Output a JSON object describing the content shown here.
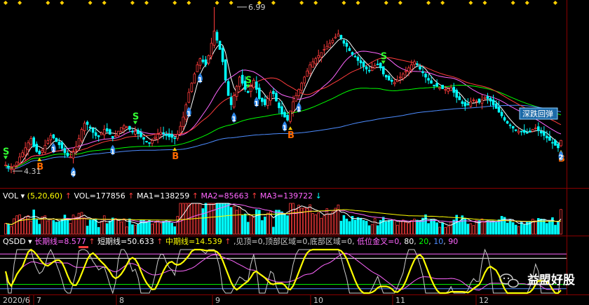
{
  "price_panel": {
    "high_label": "6.99",
    "low_label": "4.31",
    "deep_dip_label": "深跌回弹",
    "signals": [
      {
        "type": "S",
        "label": "S",
        "index": 0
      },
      {
        "type": "B",
        "label": "B",
        "index": 12
      },
      {
        "type": "n",
        "label": "1",
        "index": 17
      },
      {
        "type": "n",
        "label": "4",
        "index": 24
      },
      {
        "type": "n",
        "label": "1",
        "index": 38
      },
      {
        "type": "S",
        "label": "S",
        "index": 46
      },
      {
        "type": "B",
        "label": "B",
        "index": 60
      },
      {
        "type": "n",
        "label": "1",
        "index": 65
      },
      {
        "type": "n",
        "label": "1",
        "index": 69
      },
      {
        "type": "n",
        "label": "1",
        "index": 81
      },
      {
        "type": "S",
        "label": "S",
        "index": 86
      },
      {
        "type": "n",
        "label": "1",
        "index": 89
      },
      {
        "type": "B",
        "label": "B",
        "index": 101
      },
      {
        "type": "n",
        "label": "1",
        "index": 99
      },
      {
        "type": "n",
        "label": "1",
        "index": 104
      },
      {
        "type": "S",
        "label": "S",
        "index": 134
      },
      {
        "type": "B",
        "label": "B",
        "index": 197
      },
      {
        "type": "n",
        "label": "2",
        "index": 197
      }
    ]
  },
  "vol_panel": {
    "name": "VOL",
    "params": "(5,20,60)",
    "vol": "VOL=177856",
    "ma1": "MA1=138259",
    "ma2": "MA2=85663",
    "ma3": "MA3=139722"
  },
  "qsdd_panel": {
    "name": "QSDD",
    "long": "长期线=8.577",
    "short": "短期线=50.633",
    "mid": "中期线=14.539",
    "rest_a": ",见顶=0,顶部区域=0,底部区域=0,",
    "rest_b": "低位金叉=0,",
    "levels": [
      {
        "text": "80",
        "color": "#ffffff"
      },
      {
        "text": "20",
        "color": "#00ff00"
      },
      {
        "text": "10",
        "color": "#4d8cff"
      },
      {
        "text": "90",
        "color": "#ff66ff"
      }
    ]
  },
  "time_axis": {
    "labels": [
      "2020/6",
      "7",
      "8",
      "9",
      "10",
      "11",
      "12"
    ]
  },
  "watermark": {
    "text": "益盟好股"
  },
  "colors": {
    "up": "#ff3c3c",
    "down": "#00ffff",
    "ma5": "#ffffff",
    "ma10": "#ffff00",
    "ma20": "#ff66ff",
    "ma60": "#00ff00",
    "ma120": "#4d8cff",
    "grid": "#8a0000"
  },
  "chart_data": {
    "type": "candlestick",
    "close": [
      4.42,
      4.38,
      4.36,
      4.4,
      4.47,
      4.55,
      4.62,
      4.7,
      4.78,
      4.85,
      4.72,
      4.64,
      4.6,
      4.66,
      4.74,
      4.82,
      4.9,
      4.86,
      4.8,
      4.75,
      4.69,
      4.62,
      4.57,
      4.55,
      4.63,
      4.72,
      4.85,
      5.0,
      5.1,
      5.08,
      5.02,
      4.95,
      4.9,
      4.88,
      4.94,
      5.0,
      4.97,
      4.92,
      4.86,
      4.9,
      4.97,
      5.03,
      5.06,
      5.04,
      5.0,
      4.96,
      4.97,
      4.93,
      4.88,
      4.84,
      4.8,
      4.78,
      4.82,
      4.87,
      4.92,
      4.95,
      4.93,
      4.9,
      4.88,
      4.87,
      4.85,
      4.92,
      5.05,
      5.2,
      5.4,
      5.6,
      5.75,
      5.9,
      6.05,
      6.15,
      6.1,
      6.05,
      6.2,
      6.4,
      6.6,
      6.45,
      6.3,
      6.1,
      5.8,
      5.55,
      5.4,
      5.55,
      5.7,
      5.85,
      5.75,
      5.65,
      5.6,
      5.7,
      5.8,
      5.65,
      5.5,
      5.45,
      5.4,
      5.5,
      5.6,
      5.58,
      5.46,
      5.35,
      5.25,
      5.2,
      5.15,
      5.3,
      5.45,
      5.55,
      5.65,
      5.75,
      5.85,
      5.95,
      6.05,
      6.1,
      6.15,
      6.2,
      6.25,
      6.3,
      6.35,
      6.4,
      6.45,
      6.5,
      6.55,
      6.48,
      6.4,
      6.35,
      6.28,
      6.22,
      6.18,
      6.12,
      6.08,
      6.02,
      5.98,
      5.96,
      6.0,
      6.04,
      6.06,
      6.0,
      5.9,
      5.85,
      5.8,
      5.78,
      5.76,
      5.8,
      5.85,
      5.9,
      5.95,
      6.0,
      6.05,
      6.1,
      6.05,
      5.98,
      5.92,
      5.85,
      5.8,
      5.75,
      5.72,
      5.7,
      5.68,
      5.66,
      5.65,
      5.66,
      5.68,
      5.6,
      5.52,
      5.48,
      5.42,
      5.38,
      5.4,
      5.45,
      5.48,
      5.46,
      5.44,
      5.48,
      5.52,
      5.5,
      5.46,
      5.4,
      5.34,
      5.28,
      5.22,
      5.15,
      5.1,
      5.06,
      5.02,
      4.98,
      4.97,
      4.96,
      4.95,
      4.94,
      4.97,
      5.0,
      5.02,
      4.98,
      4.94,
      4.9,
      4.86,
      4.82,
      4.78,
      4.74,
      4.7,
      4.82
    ],
    "high_price": 6.99,
    "low_price": 4.31
  }
}
